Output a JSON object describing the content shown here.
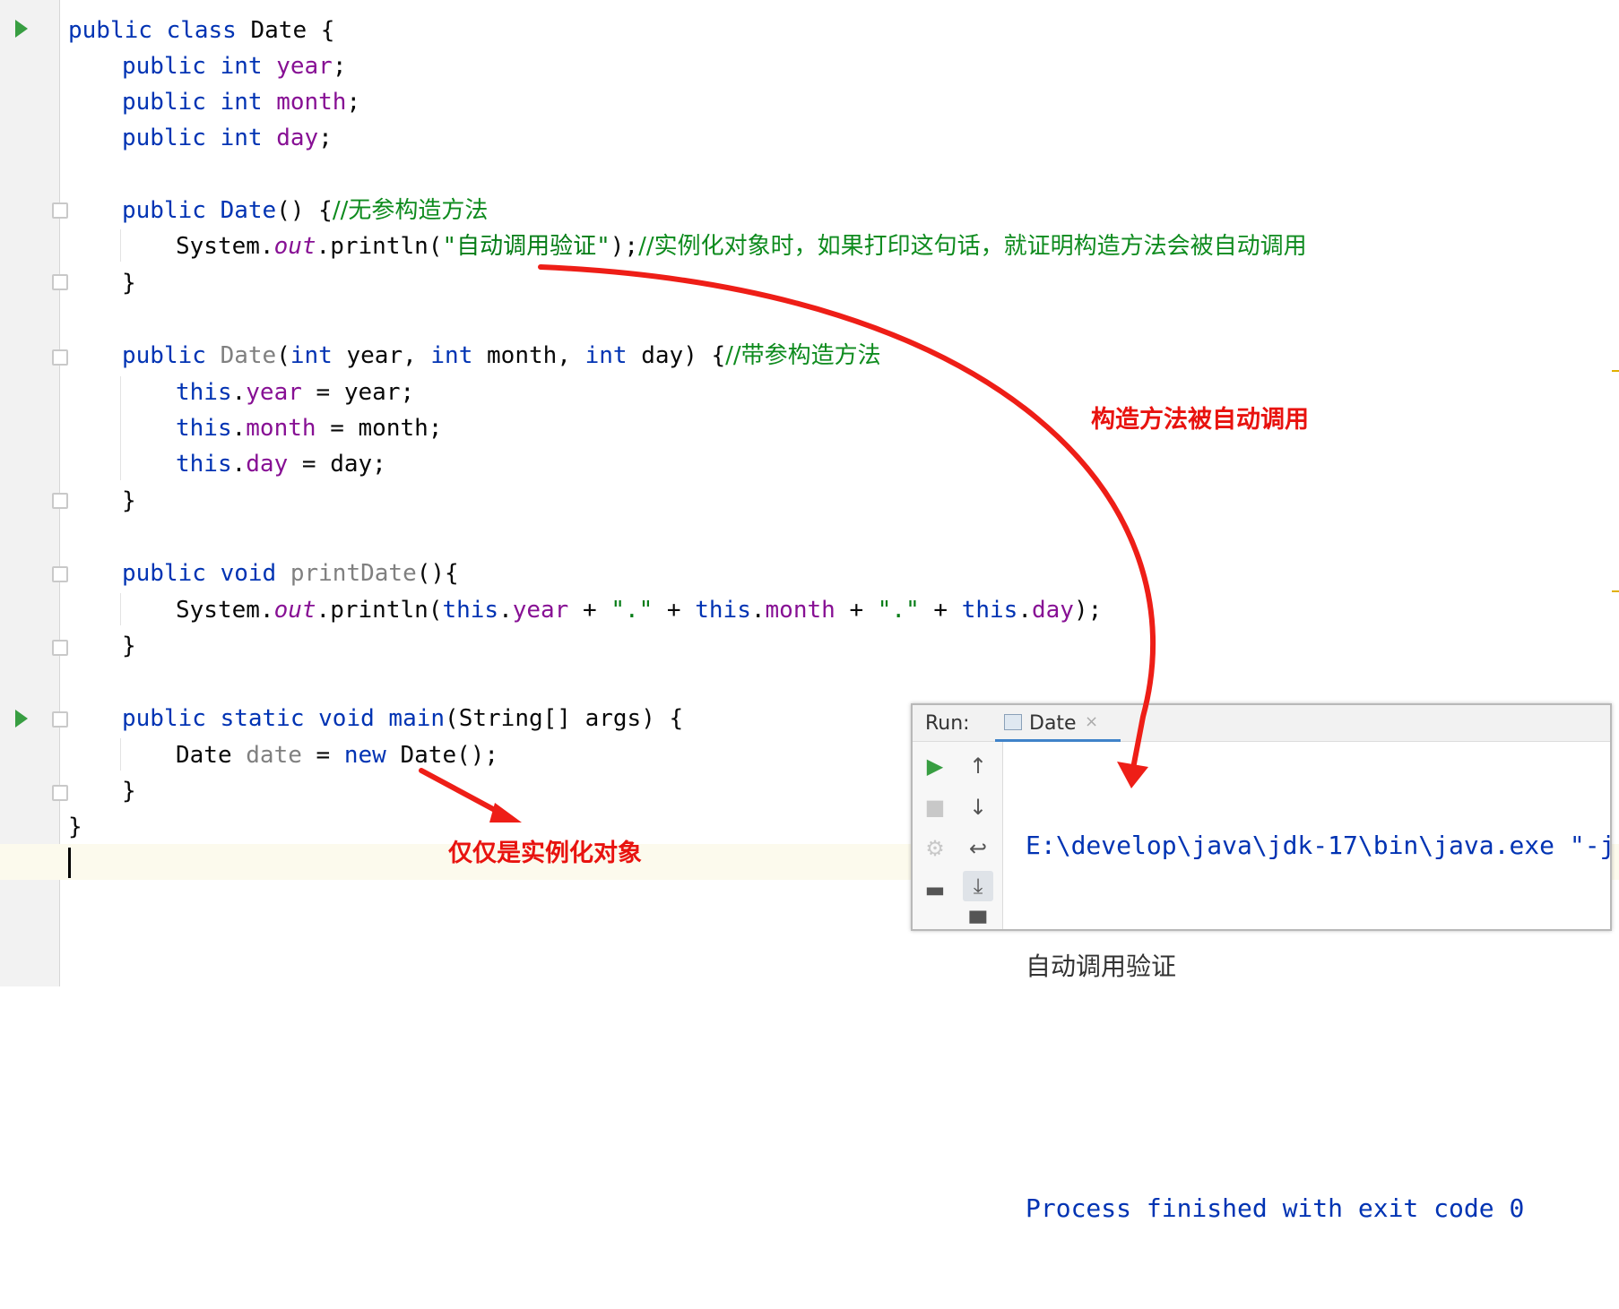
{
  "editor": {
    "code": {
      "l1": {
        "t1": "public class ",
        "t2": "Date",
        "t3": " {"
      },
      "l2": {
        "t1": "public int ",
        "t2": "year",
        "t3": ";"
      },
      "l3": {
        "t1": "public int ",
        "t2": "month",
        "t3": ";"
      },
      "l4": {
        "t1": "public int ",
        "t2": "day",
        "t3": ";"
      },
      "l5": {
        "t1": "public ",
        "t2": "Date",
        "t3": "() {",
        "t4": "//无参构造方法"
      },
      "l6": {
        "t1": "System.",
        "t2": "out",
        "t3": ".println(",
        "t4": "\"自动调用验证\"",
        "t5": ");",
        "t6": "//实例化对象时，如果打印这句话，就证明构造方法会被自动调用"
      },
      "l7": {
        "t1": "}"
      },
      "l8": {
        "t1": "public ",
        "t2": "Date",
        "t3": "(",
        "t4": "int",
        "t5": " year, ",
        "t6": "int",
        "t7": " month, ",
        "t8": "int",
        "t9": " day) {",
        "t10": "//带参构造方法"
      },
      "l9": {
        "t1": "this",
        "t2": ".",
        "t3": "year",
        "t4": " = year;"
      },
      "l10": {
        "t1": "this",
        "t2": ".",
        "t3": "month",
        "t4": " = month;"
      },
      "l11": {
        "t1": "this",
        "t2": ".",
        "t3": "day",
        "t4": " = day;"
      },
      "l12": {
        "t1": "}"
      },
      "l13": {
        "t1": "public void ",
        "t2": "printDate",
        "t3": "(){"
      },
      "l14": {
        "t1": "System.",
        "t2": "out",
        "t3": ".println(",
        "t4": "this",
        "t5": ".",
        "t6": "year",
        "t7": " + ",
        "t8": "\".\"",
        "t9": " + ",
        "t10": "this",
        "t11": ".",
        "t12": "month",
        "t13": " + ",
        "t14": "\".\"",
        "t15": " + ",
        "t16": "this",
        "t17": ".",
        "t18": "day",
        "t19": ");"
      },
      "l15": {
        "t1": "}"
      },
      "l16": {
        "t1": "public static void ",
        "t2": "main",
        "t3": "(String[] args) {"
      },
      "l17": {
        "t1": "Date ",
        "t2": "date",
        "t3": " = ",
        "t4": "new",
        "t5": " Date();"
      },
      "l18": {
        "t1": "}"
      },
      "l19": {
        "t1": "}"
      }
    }
  },
  "annotations": {
    "constructor_called": "构造方法被自动调用",
    "only_instantiate": "仅仅是实例化对象"
  },
  "run_panel": {
    "label": "Run:",
    "tab_name": "Date",
    "tab_close": "×",
    "console": {
      "command": "E:\\develop\\java\\jdk-17\\bin\\java.exe \"-j",
      "output": "自动调用验证",
      "process": "Process finished with exit code 0"
    }
  },
  "colors": {
    "keyword": "#0033b3",
    "field": "#871094",
    "string": "#067d17",
    "comment": "#0e8b1e",
    "annotation": "#e8130f",
    "run_green": "#389e42"
  }
}
